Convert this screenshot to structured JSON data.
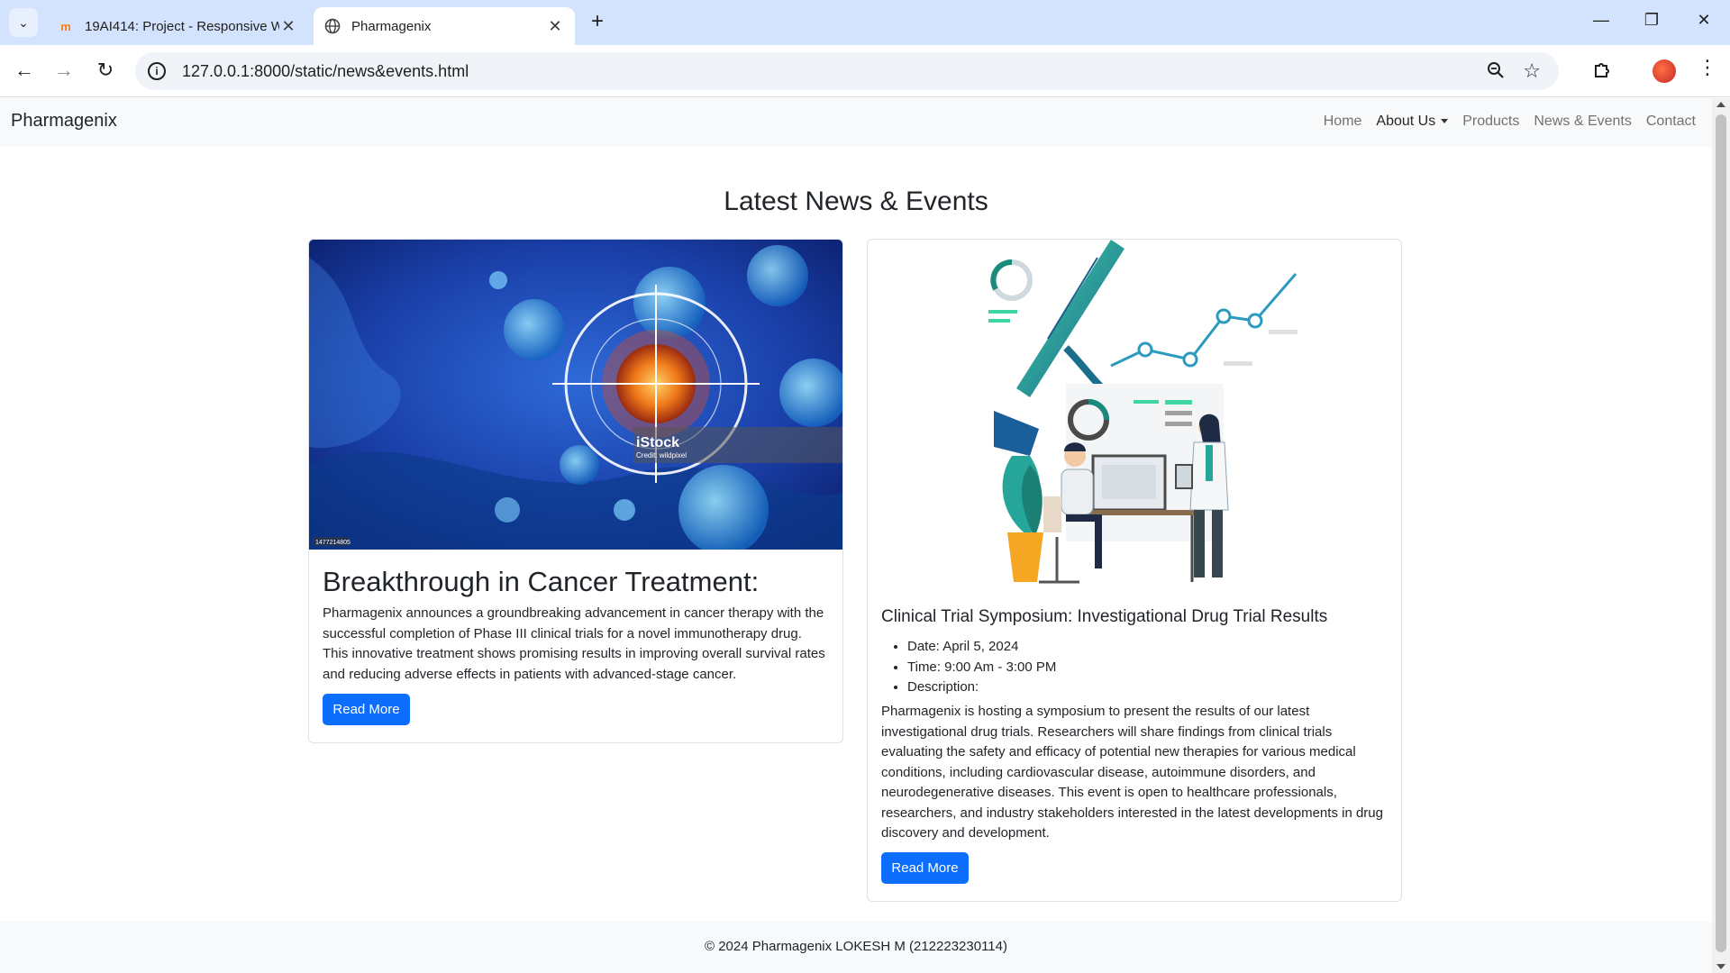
{
  "browser": {
    "tabs": [
      {
        "title": "19AI414: Project - Responsive W",
        "active": false
      },
      {
        "title": "Pharmagenix",
        "active": true
      }
    ],
    "url": "127.0.0.1:8000/static/news&events.html"
  },
  "site": {
    "brand": "Pharmagenix",
    "nav": {
      "home": "Home",
      "about": "About Us",
      "products": "Products",
      "news": "News & Events",
      "contact": "Contact"
    },
    "heading": "Latest News & Events"
  },
  "news_card": {
    "image_watermark": "iStock",
    "image_credit": "Credit: wildpixel",
    "image_id": "1477214805",
    "title": "Breakthrough in Cancer Treatment:",
    "text": "Pharmagenix announces a groundbreaking advancement in cancer therapy with the successful completion of Phase III clinical trials for a novel immunotherapy drug. This innovative treatment shows promising results in improving overall survival rates and reducing adverse effects in patients with advanced-stage cancer.",
    "button": "Read More"
  },
  "event_card": {
    "title": "Clinical Trial Symposium: Investigational Drug Trial Results",
    "details": {
      "date": "Date: April 5, 2024",
      "time": "Time: 9:00 Am - 3:00 PM",
      "description": "Description:"
    },
    "text": "Pharmagenix is hosting a symposium to present the results of our latest investigational drug trials. Researchers will share findings from clinical trials evaluating the safety and efficacy of potential new therapies for various medical conditions, including cardiovascular disease, autoimmune disorders, and neurodegenerative diseases. This event is open to healthcare professionals, researchers, and industry stakeholders interested in the latest developments in drug discovery and development.",
    "button": "Read More"
  },
  "footer": {
    "text": "© 2024 Pharmagenix LOKESH M (212223230114)"
  },
  "colors": {
    "primary": "#0d6efd",
    "navbar_bg": "#f8f9fa",
    "tabbar_bg": "#d3e3fd"
  }
}
